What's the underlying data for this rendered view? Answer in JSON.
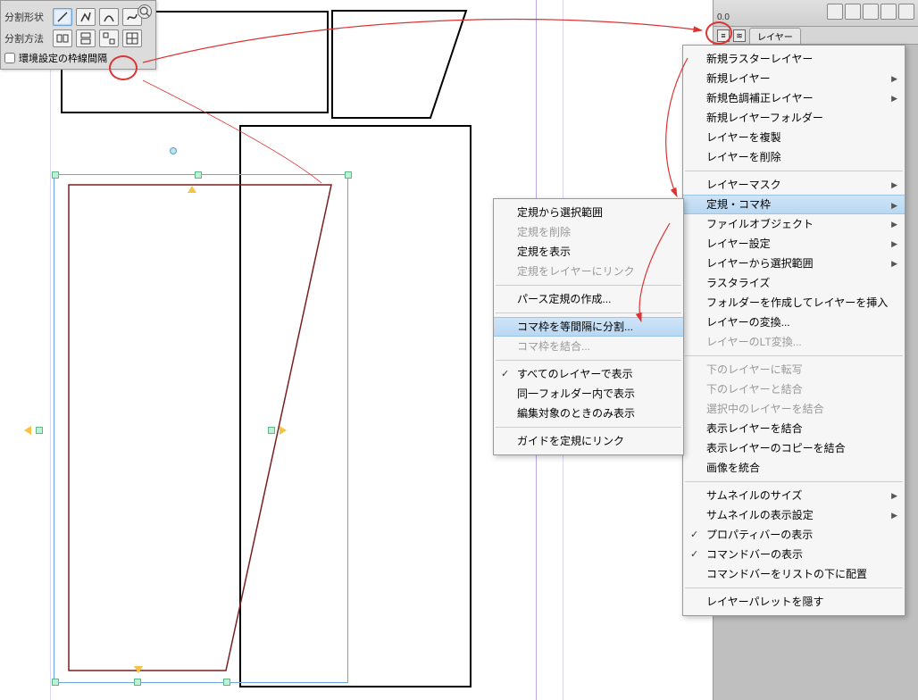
{
  "palette": {
    "row1_label": "分割形状",
    "row2_label": "分割方法",
    "checkbox_label": "環境設定の枠線間隔",
    "shape_icons": [
      "line-icon",
      "polyline-icon",
      "curve-icon",
      "spline-icon"
    ],
    "method_icons": [
      "split-a-icon",
      "split-b-icon",
      "split-c-icon",
      "split-d-icon"
    ]
  },
  "right_rail": {
    "readout": "0.0",
    "tab_label": "レイヤー",
    "tab_labels": [
      "≡",
      "≋"
    ]
  },
  "menu_main": {
    "items": [
      {
        "label": "新規ラスターレイヤー"
      },
      {
        "label": "新規レイヤー",
        "sub": true
      },
      {
        "label": "新規色調補正レイヤー",
        "sub": true
      },
      {
        "label": "新規レイヤーフォルダー"
      },
      {
        "label": "レイヤーを複製"
      },
      {
        "label": "レイヤーを削除"
      },
      {
        "sep": true
      },
      {
        "label": "レイヤーマスク",
        "sub": true
      },
      {
        "label": "定規・コマ枠",
        "sub": true,
        "highlight": true
      },
      {
        "label": "ファイルオブジェクト",
        "sub": true
      },
      {
        "label": "レイヤー設定",
        "sub": true
      },
      {
        "label": "レイヤーから選択範囲",
        "sub": true
      },
      {
        "label": "ラスタライズ"
      },
      {
        "label": "フォルダーを作成してレイヤーを挿入"
      },
      {
        "label": "レイヤーの変換..."
      },
      {
        "label": "レイヤーのLT変換...",
        "disabled": true
      },
      {
        "sep": true
      },
      {
        "label": "下のレイヤーに転写",
        "disabled": true
      },
      {
        "label": "下のレイヤーと結合",
        "disabled": true
      },
      {
        "label": "選択中のレイヤーを結合",
        "disabled": true
      },
      {
        "label": "表示レイヤーを結合"
      },
      {
        "label": "表示レイヤーのコピーを結合"
      },
      {
        "label": "画像を統合"
      },
      {
        "sep": true
      },
      {
        "label": "サムネイルのサイズ",
        "sub": true
      },
      {
        "label": "サムネイルの表示設定",
        "sub": true
      },
      {
        "label": "プロパティバーの表示",
        "checked": true
      },
      {
        "label": "コマンドバーの表示",
        "checked": true
      },
      {
        "label": "コマンドバーをリストの下に配置"
      },
      {
        "sep": true
      },
      {
        "label": "レイヤーパレットを隠す"
      }
    ]
  },
  "menu_sub": {
    "items": [
      {
        "label": "定規から選択範囲"
      },
      {
        "label": "定規を削除",
        "disabled": true
      },
      {
        "label": "定規を表示"
      },
      {
        "label": "定規をレイヤーにリンク",
        "disabled": true
      },
      {
        "sep": true
      },
      {
        "label": "パース定規の作成..."
      },
      {
        "sep": true
      },
      {
        "label": "コマ枠を等間隔に分割...",
        "highlight": true
      },
      {
        "label": "コマ枠を結合...",
        "disabled": true
      },
      {
        "sep": true
      },
      {
        "label": "すべてのレイヤーで表示",
        "checked": true
      },
      {
        "label": "同一フォルダー内で表示"
      },
      {
        "label": "編集対象のときのみ表示"
      },
      {
        "sep": true
      },
      {
        "label": "ガイドを定規にリンク"
      }
    ]
  }
}
